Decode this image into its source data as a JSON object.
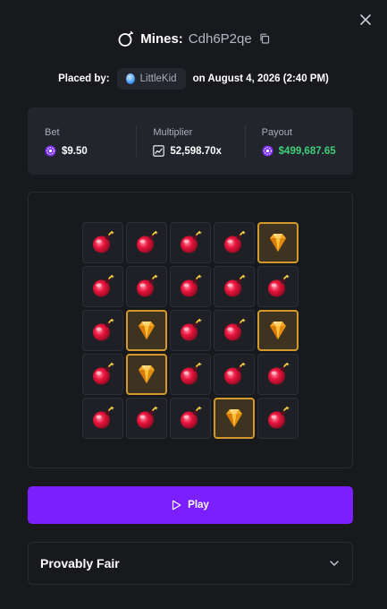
{
  "header": {
    "title_prefix": "Mines:",
    "game_id": "Cdh6P2qe"
  },
  "placed": {
    "label": "Placed by:",
    "username": "LittleKid",
    "date_text": "on August 4, 2026 (2:40 PM)"
  },
  "stats": {
    "bet_label": "Bet",
    "bet_value": "$9.50",
    "multiplier_label": "Multiplier",
    "multiplier_value": "52,598.70x",
    "payout_label": "Payout",
    "payout_value": "$499,687.65"
  },
  "board": {
    "rows": [
      [
        "mine",
        "mine",
        "mine",
        "mine",
        "gem"
      ],
      [
        "mine",
        "mine",
        "mine",
        "mine",
        "mine"
      ],
      [
        "mine",
        "gem",
        "mine",
        "mine",
        "gem"
      ],
      [
        "mine",
        "gem",
        "mine",
        "mine",
        "mine"
      ],
      [
        "mine",
        "mine",
        "mine",
        "gem",
        "mine"
      ]
    ]
  },
  "play_button": {
    "label": "Play"
  },
  "provably_fair": {
    "title": "Provably Fair"
  },
  "colors": {
    "background": "#18191d",
    "accent": "#7b1fff",
    "payout_green": "#3ecf7a",
    "gem_border": "#d39a2b"
  },
  "icons": {
    "close": "close-icon",
    "title": "mine-icon",
    "copy": "copy-icon",
    "coin": "coin-icon",
    "multiplier": "trend-chart-icon",
    "play": "play-icon",
    "expand": "chevron-down-icon"
  }
}
